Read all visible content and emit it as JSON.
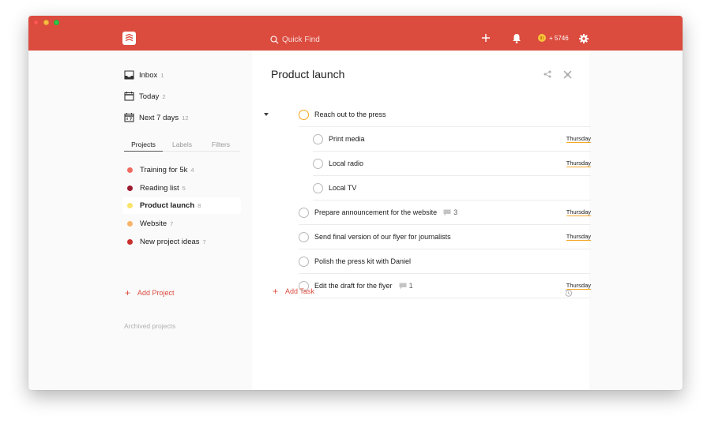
{
  "app": {
    "search_placeholder": "Quick Find",
    "karma": "+ 5746",
    "colors": {
      "brand": "#db4c3f",
      "accent": "#f5a623"
    }
  },
  "sidebar": {
    "filters": [
      {
        "label": "Inbox",
        "count": "1",
        "icon": "inbox-icon"
      },
      {
        "label": "Today",
        "count": "2",
        "icon": "calendar-icon"
      },
      {
        "label": "Next 7 days",
        "count": "12",
        "icon": "calendar-7-icon"
      }
    ],
    "tabs": [
      "Projects",
      "Labels",
      "Filters"
    ],
    "active_tab": "Projects",
    "projects": [
      {
        "label": "Training for 5k",
        "count": "4",
        "color": "#f06b5f"
      },
      {
        "label": "Reading list",
        "count": "5",
        "color": "#9b1b30"
      },
      {
        "label": "Product launch",
        "count": "8",
        "color": "#f9e46a"
      },
      {
        "label": "Website",
        "count": "7",
        "color": "#f9b36a"
      },
      {
        "label": "New project ideas",
        "count": "7",
        "color": "#c9302c"
      }
    ],
    "selected_project": "Product launch",
    "add_project": "Add Project",
    "archived": "Archived projects"
  },
  "main": {
    "title": "Product launch",
    "tasks": [
      {
        "name": "Reach out to the press",
        "due": "",
        "comments": "",
        "level": 0,
        "collapsible": true,
        "priority_color": "#f5a623"
      },
      {
        "name": "Print media",
        "due": "Thursday",
        "comments": "",
        "level": 1
      },
      {
        "name": "Local radio",
        "due": "Thursday",
        "comments": "",
        "level": 1
      },
      {
        "name": "Local TV",
        "due": "",
        "comments": "",
        "level": 1
      },
      {
        "name": "Prepare announcement for the website",
        "due": "Thursday",
        "comments": "3",
        "level": 0
      },
      {
        "name": "Send final version of our flyer for journalists",
        "due": "Thursday",
        "comments": "",
        "level": 0
      },
      {
        "name": "Polish the press kit with Daniel",
        "due": "",
        "comments": "",
        "level": 0
      },
      {
        "name": "Edit the draft for the flyer",
        "due": "Thursday",
        "comments": "1",
        "level": 0
      }
    ],
    "add_task": "Add Task"
  }
}
